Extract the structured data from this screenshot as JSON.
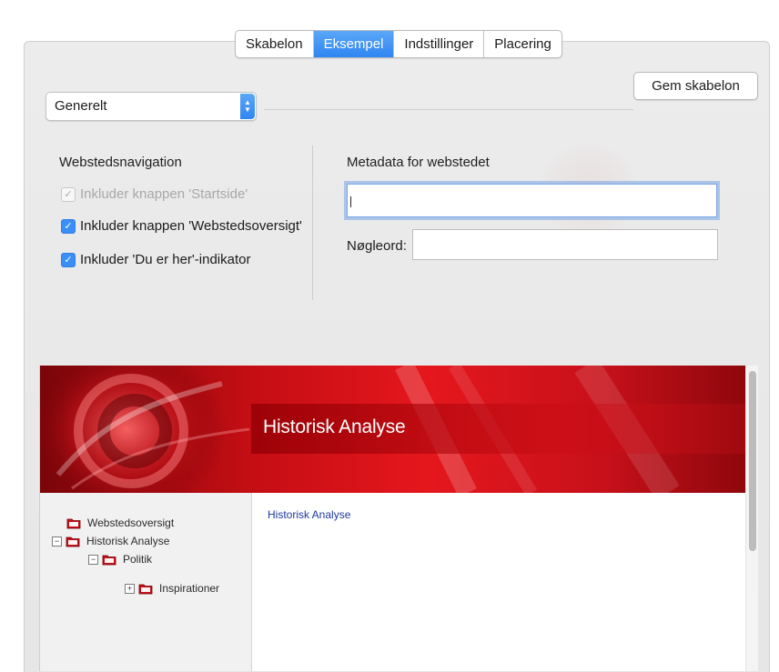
{
  "tabs": [
    {
      "label": "Skabelon",
      "active": false
    },
    {
      "label": "Eksempel",
      "active": true
    },
    {
      "label": "Indstillinger",
      "active": false
    },
    {
      "label": "Placering",
      "active": false
    }
  ],
  "toolbar": {
    "save_template_label": "Gem skabelon"
  },
  "section_select": {
    "value": "Generelt"
  },
  "navigation": {
    "title": "Webstedsnavigation",
    "options": [
      {
        "label": "Inkluder knappen 'Startside'",
        "checked": true,
        "enabled": false
      },
      {
        "label": "Inkluder knappen 'Webstedsoversigt'",
        "checked": true,
        "enabled": true
      },
      {
        "label": "Inkluder 'Du er her'-indikator",
        "checked": true,
        "enabled": true
      }
    ]
  },
  "metadata": {
    "title": "Metadata for webstedet",
    "description_value": "",
    "keywords_label": "Nøgleord:",
    "keywords_value": ""
  },
  "preview": {
    "banner_title": "Historisk Analyse",
    "tree": [
      {
        "label": "Webstedsoversigt",
        "toggle": ""
      },
      {
        "label": "Historisk Analyse",
        "toggle": "−"
      },
      {
        "label": "Politik",
        "toggle": "−"
      },
      {
        "label": "Inspirationer",
        "toggle": "+"
      }
    ],
    "content_link": "Historisk Analyse"
  },
  "colors": {
    "accent": "#3a8ef6",
    "banner_red": "#d4131a",
    "link_blue": "#1d3b9a"
  }
}
